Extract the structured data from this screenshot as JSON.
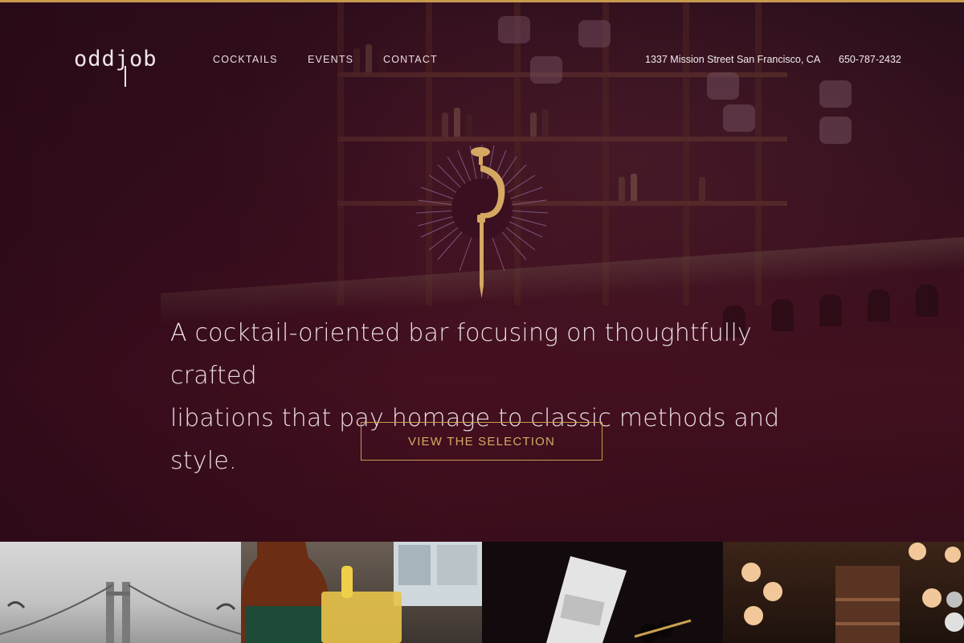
{
  "brand": {
    "logo_text": "oddjob"
  },
  "nav": {
    "links": [
      {
        "label": "COCKTAILS"
      },
      {
        "label": "EVENTS"
      },
      {
        "label": "CONTACT"
      }
    ],
    "address": "1337 Mission Street San Francisco, CA",
    "phone": "650-787-2432"
  },
  "hero": {
    "tagline_line1": "A cocktail-oriented bar focusing on thoughtfully crafted",
    "tagline_line2": "libations that pay homage to classic methods and style.",
    "cta_label": "VIEW THE SELECTION"
  },
  "colors": {
    "accent_gold": "#c89a4e",
    "hero_bg": "#3a1020"
  },
  "gallery": [
    {
      "image": "golden-gate-bridge-fog-photo"
    },
    {
      "image": "bourbon-and-cocktail-photo"
    },
    {
      "image": "martini-with-olives-photo"
    },
    {
      "image": "bar-interior-lamps-photo"
    }
  ]
}
